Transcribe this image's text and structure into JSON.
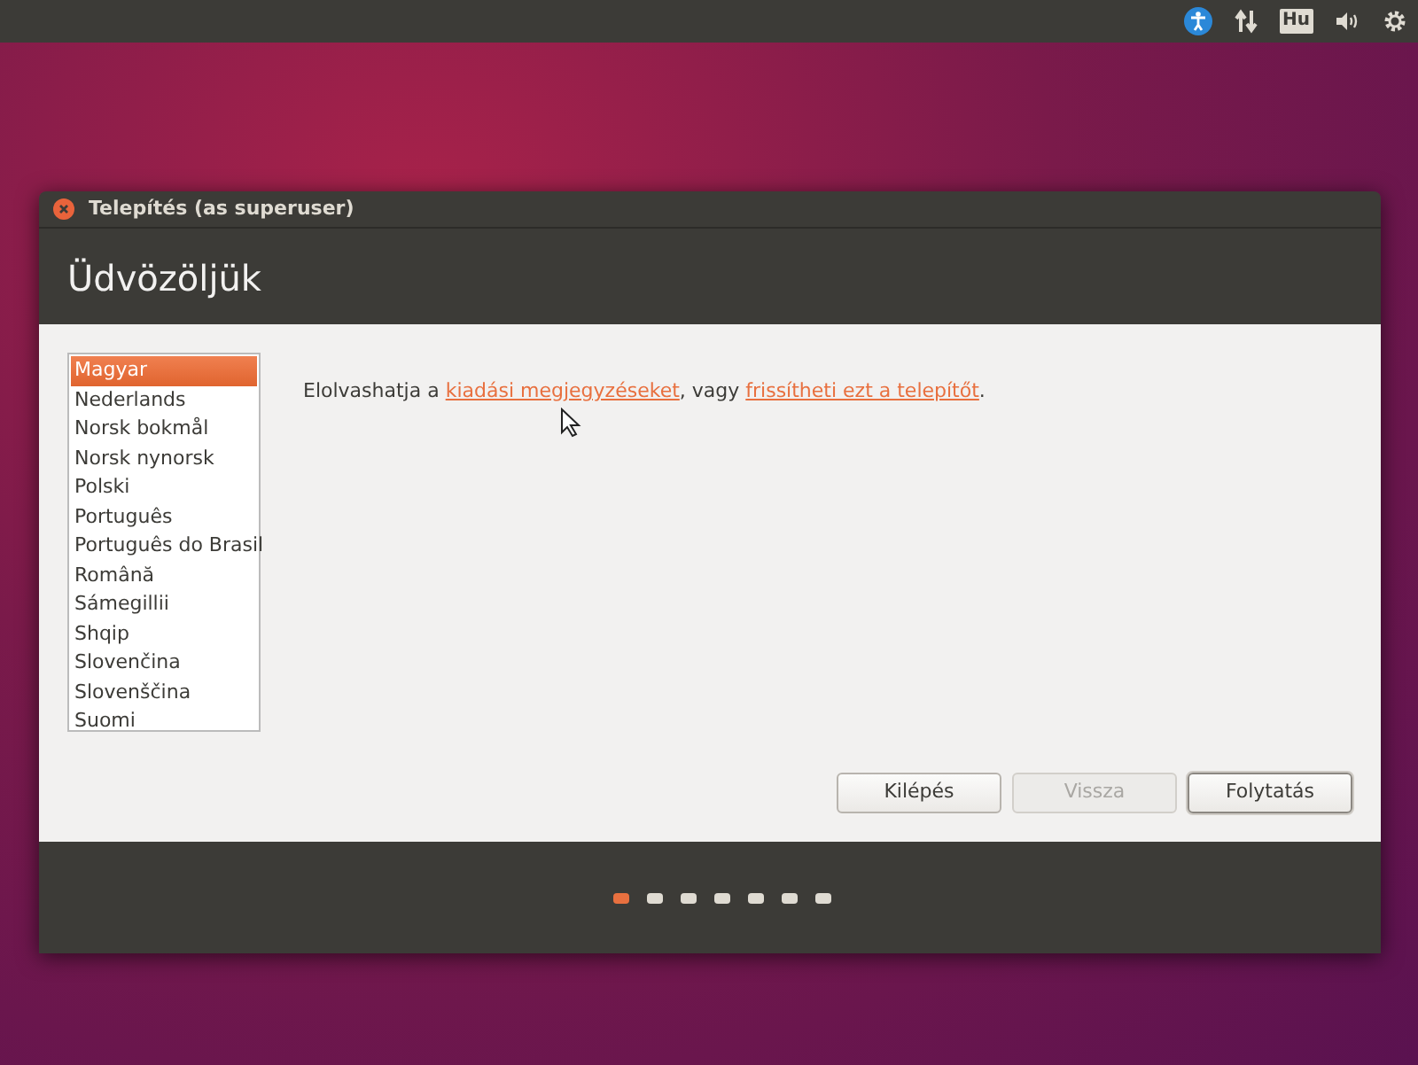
{
  "top_panel": {
    "keyboard_layout": "Hu"
  },
  "window": {
    "title": "Telepítés (as superuser)",
    "heading": "Üdvözöljük"
  },
  "languages": [
    {
      "label": "Magyar",
      "selected": true
    },
    {
      "label": "Nederlands",
      "selected": false
    },
    {
      "label": "Norsk bokmål",
      "selected": false
    },
    {
      "label": "Norsk nynorsk",
      "selected": false
    },
    {
      "label": "Polski",
      "selected": false
    },
    {
      "label": "Português",
      "selected": false
    },
    {
      "label": "Português do Brasil",
      "selected": false
    },
    {
      "label": "Română",
      "selected": false
    },
    {
      "label": "Sámegillii",
      "selected": false
    },
    {
      "label": "Shqip",
      "selected": false
    },
    {
      "label": "Slovenčina",
      "selected": false
    },
    {
      "label": "Slovenščina",
      "selected": false
    },
    {
      "label": "Suomi",
      "selected": false
    }
  ],
  "intro": [
    {
      "kind": "text",
      "text": "Elolvashatja a "
    },
    {
      "kind": "link",
      "text": "kiadási megjegyzéseket"
    },
    {
      "kind": "text",
      "text": ", vagy "
    },
    {
      "kind": "link",
      "text": "frissítheti ezt a telepítőt"
    },
    {
      "kind": "text",
      "text": "."
    }
  ],
  "buttons": [
    {
      "label": "Kilépés",
      "disabled": false,
      "default": false
    },
    {
      "label": "Vissza",
      "disabled": true,
      "default": false
    },
    {
      "label": "Folytatás",
      "disabled": false,
      "default": true
    }
  ],
  "steps": [
    {
      "selected": true
    },
    {
      "selected": false
    },
    {
      "selected": false
    },
    {
      "selected": false
    },
    {
      "selected": false
    },
    {
      "selected": false
    },
    {
      "selected": false
    }
  ]
}
